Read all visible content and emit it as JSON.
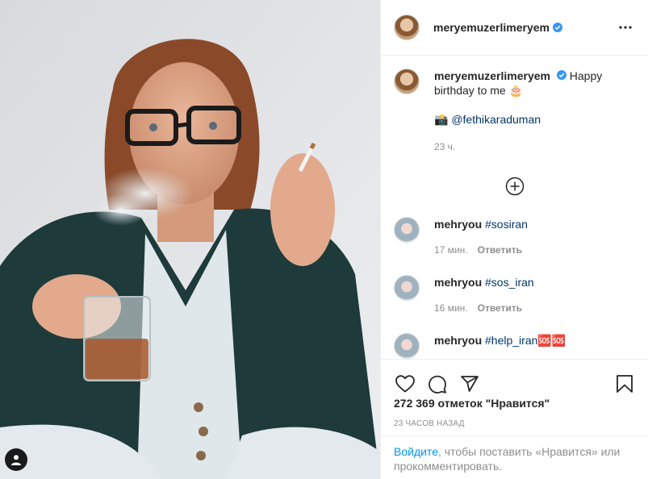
{
  "post": {
    "author": "meryemuzerlimeryem",
    "caption_text": "Happy birthday to me 🎂",
    "caption_line2_prefix": "📸",
    "caption_mention": "@fethikaraduman",
    "time_ago": "23 ч."
  },
  "comments": [
    {
      "user": "mehryou",
      "hashtag": "#sosiran",
      "time": "17 мин.",
      "reply_label": "Ответить"
    },
    {
      "user": "mehryou",
      "hashtag": "#sos_iran",
      "time": "16 мин.",
      "reply_label": "Ответить"
    },
    {
      "user": "mehryou",
      "hashtag": "#help_iran🆘🆘",
      "time": "",
      "reply_label": ""
    }
  ],
  "likes_text": "272 369 отметок \"Нравится\"",
  "posted_ago": "23 ЧАСОВ НАЗАД",
  "login_prompt": {
    "link": "Войдите",
    "rest": ", чтобы поставить «Нравится» или прокомментировать."
  },
  "icons": {
    "verified": "verified-badge-icon",
    "more": "more-dots-icon",
    "load_more": "plus-circle-icon",
    "like": "heart-icon",
    "comment": "comment-bubble-icon",
    "share": "paper-plane-icon",
    "save": "bookmark-icon",
    "user_tag": "user-tag-icon"
  },
  "colors": {
    "verified_blue": "#3897f0",
    "link_blue": "#00376b",
    "login_blue": "#0095f6",
    "muted": "#8e8e8e"
  }
}
